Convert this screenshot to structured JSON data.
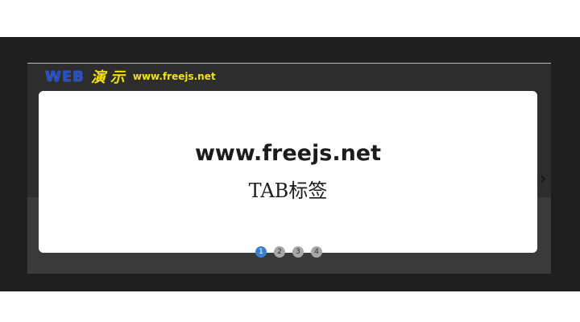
{
  "header": {
    "logo_web": "WEB",
    "logo_cn": "演示",
    "logo_url": "www.freejs.net"
  },
  "slide": {
    "title": "www.freejs.net",
    "subtitle": "TAB标签"
  },
  "controls": {
    "next_symbol": "›"
  },
  "pager": {
    "active_index": 1,
    "items": [
      "1",
      "2",
      "3",
      "4"
    ]
  },
  "colors": {
    "page_background": "#ffffff",
    "dark_band": "#1f1f1f",
    "frame": "#2d2d2d",
    "logo_blue": "#1e4fd1",
    "logo_yellow": "#f2e400",
    "active_dot": "#3b7fd1",
    "inactive_dot": "#a7a7a7"
  }
}
